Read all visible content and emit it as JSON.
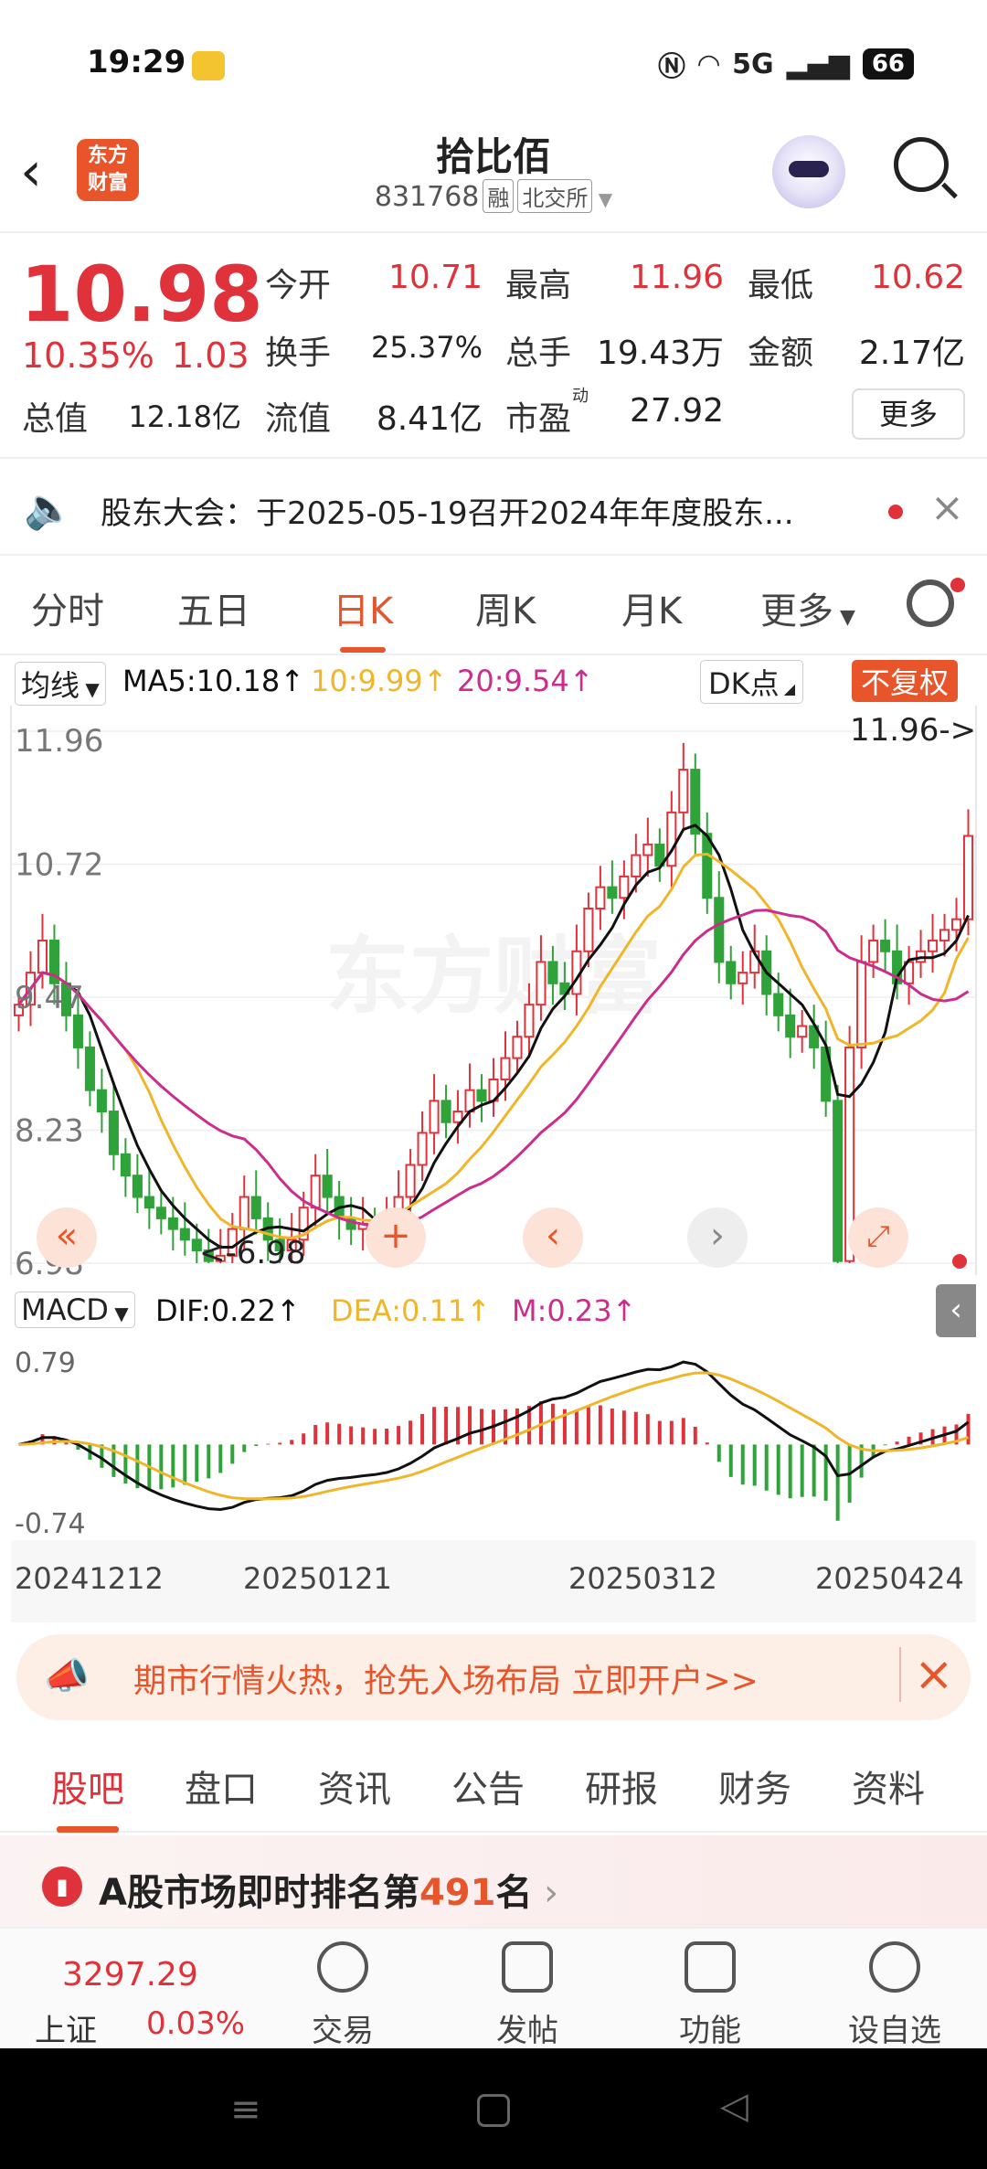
{
  "status": {
    "time": "19:29",
    "network": "5G",
    "battery": "66"
  },
  "header": {
    "title": "拾比佰",
    "code": "831768",
    "tag1": "融",
    "tag2": "北交所",
    "logo_line1": "东方",
    "logo_line2": "财富"
  },
  "quote": {
    "price": "10.98",
    "change_pct": "10.35%",
    "change": "1.03",
    "open_label": "今开",
    "open": "10.71",
    "high_label": "最高",
    "high": "11.96",
    "low_label": "最低",
    "low": "10.62",
    "turnover_label": "换手",
    "turnover": "25.37%",
    "volume_label": "总手",
    "volume": "19.43万",
    "amount_label": "金额",
    "amount": "2.17亿",
    "mktcap_label": "总值",
    "mktcap": "12.18亿",
    "float_label": "流值",
    "float": "8.41亿",
    "pe_label": "市盈",
    "pe_sup": "动",
    "pe": "27.92",
    "more": "更多"
  },
  "notice": {
    "text": "股东大会：于2025-05-19召开2024年年度股东..."
  },
  "tabs": [
    "分时",
    "五日",
    "日K",
    "周K",
    "月K",
    "更多"
  ],
  "ma": {
    "selector": "均线",
    "ma5": "MA5:10.18↑",
    "ma10": "10:9.99↑",
    "ma20": "20:9.54↑",
    "dk": "DK点",
    "fq": "不复权"
  },
  "macd": {
    "selector": "MACD",
    "dif": "DIF:0.22↑",
    "dea": "DEA:0.11↑",
    "m": "M:0.23↑"
  },
  "chart_data": {
    "type": "candlestick",
    "y_ticks": [
      "11.96",
      "10.72",
      "9.47",
      "8.23",
      "6.98"
    ],
    "ylim": [
      6.98,
      11.96
    ],
    "max_marker": "11.96->",
    "min_marker": "<-6.98",
    "macd_ticks": [
      "0.79",
      "-0.74"
    ],
    "dates": [
      "20241212",
      "20250121",
      "20250312",
      "20250424"
    ],
    "watermark": "东方财富",
    "colors": {
      "up": "#e0323a",
      "down": "#2fa33a",
      "ma5": "#111111",
      "ma10": "#f0b62b",
      "ma20": "#cc2d8d"
    },
    "closes": [
      9.4,
      9.7,
      10.0,
      9.6,
      9.3,
      9.0,
      8.6,
      8.4,
      8.0,
      7.8,
      7.6,
      7.5,
      7.4,
      7.3,
      7.2,
      7.1,
      7.0,
      7.05,
      7.3,
      7.6,
      7.4,
      7.2,
      7.1,
      7.2,
      7.5,
      7.8,
      7.6,
      7.4,
      7.3,
      7.35,
      7.3,
      7.4,
      7.6,
      7.9,
      8.2,
      8.5,
      8.3,
      8.4,
      8.6,
      8.5,
      8.7,
      8.9,
      9.1,
      9.4,
      9.8,
      9.6,
      9.5,
      9.9,
      10.3,
      10.5,
      10.4,
      10.6,
      10.8,
      10.9,
      10.7,
      11.2,
      11.6,
      11.0,
      10.4,
      9.8,
      9.6,
      9.7,
      9.9,
      9.5,
      9.3,
      9.1,
      9.2,
      9.0,
      8.5,
      7.0,
      9.0,
      9.8,
      10.0,
      9.9,
      9.6,
      9.8,
      9.9,
      10.0,
      10.1,
      10.2,
      10.98
    ]
  },
  "ad": {
    "text": "期市行情火热，抢先入场布局 立即开户>>"
  },
  "subtabs": [
    "股吧",
    "盘口",
    "资讯",
    "公告",
    "研报",
    "财务",
    "资料"
  ],
  "rank": {
    "prefix": "A股市场即时排名第",
    "num": "491",
    "suffix": "名"
  },
  "bottom": {
    "index_value": "3297.29",
    "index_name": "上证",
    "index_change": "0.03%",
    "items": [
      "交易",
      "发帖",
      "功能",
      "设自选"
    ]
  }
}
